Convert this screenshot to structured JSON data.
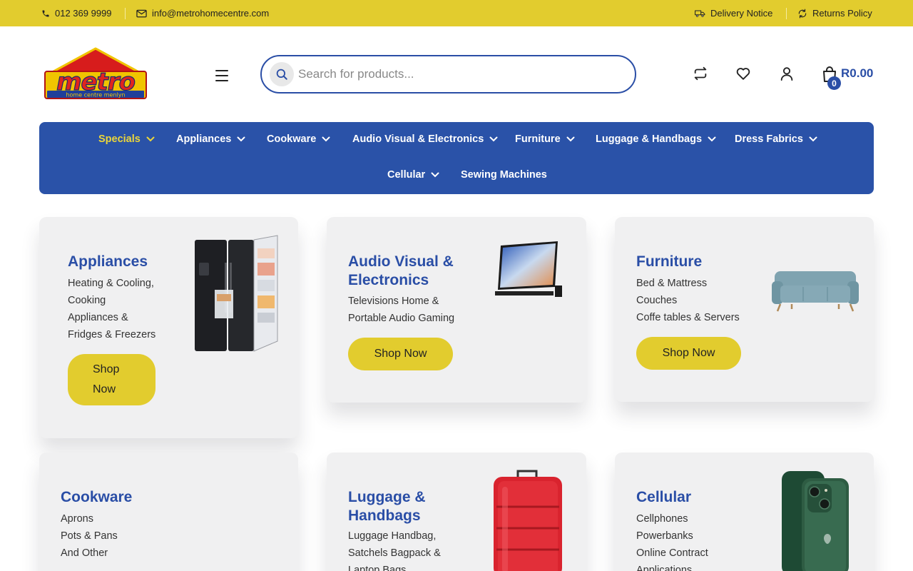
{
  "topbar": {
    "phone": "012 369 9999",
    "email": "info@metrohomecentre.com",
    "delivery": "Delivery Notice",
    "returns": "Returns Policy"
  },
  "header": {
    "logo_text": "metro",
    "logo_sub": "home centre menlyn",
    "search_placeholder": "Search for products...",
    "cart_count": "0",
    "cart_total": "R0.00"
  },
  "nav": {
    "items": [
      {
        "label": "Specials"
      },
      {
        "label": "Appliances"
      },
      {
        "label": "Cookware"
      },
      {
        "label": "Audio Visual & Electronics"
      },
      {
        "label": "Furniture"
      },
      {
        "label": "Luggage & Handbags"
      },
      {
        "label": "Dress Fabrics"
      },
      {
        "label": "Cellular"
      },
      {
        "label": "Sewing Machines"
      }
    ]
  },
  "cards": [
    {
      "title": "Appliances",
      "lines": [
        "Heating & Cooling,",
        "Cooking",
        "Appliances &",
        "Fridges & Freezers"
      ],
      "button": [
        "Shop",
        "Now"
      ]
    },
    {
      "title": [
        "Audio Visual &",
        "Electronics"
      ],
      "lines": [
        "Televisions Home &",
        "Portable Audio Gaming"
      ],
      "button": "Shop Now"
    },
    {
      "title": "Furniture",
      "lines": [
        "Bed & Mattress",
        "Couches",
        "Coffe tables & Servers"
      ],
      "button": "Shop Now"
    },
    {
      "title": "Cookware",
      "lines": [
        "Aprons",
        "Pots & Pans",
        "And Other"
      ]
    },
    {
      "title": [
        "Luggage &",
        "Handbags"
      ],
      "lines": [
        "Luggage Handbag,",
        "Satchels Bagpack &",
        "Laptop Bags"
      ]
    },
    {
      "title": "Cellular",
      "lines": [
        "Cellphones",
        "Powerbanks",
        "Online Contract",
        "Applications"
      ]
    }
  ],
  "colors": {
    "topbar": "#e2cc2e",
    "brand_blue": "#2a52a8",
    "accent_yellow": "#e2cc2e",
    "card_bg": "#f0f0f1"
  }
}
